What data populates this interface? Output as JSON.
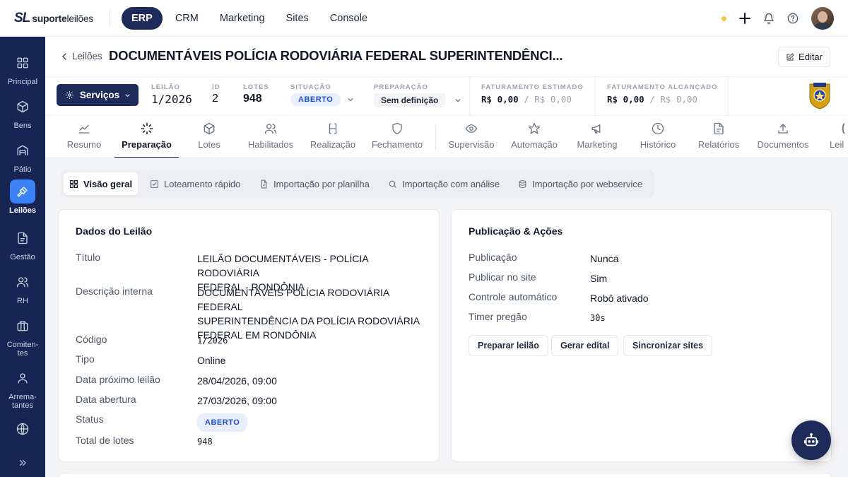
{
  "brand": {
    "mark": "SL",
    "name_bold": "suporte",
    "name_light": "leilões"
  },
  "top_nav": [
    "ERP",
    "CRM",
    "Marketing",
    "Sites",
    "Console"
  ],
  "sidebar": [
    {
      "label": "Principal",
      "icon": "dashboard-icon"
    },
    {
      "label": "Bens",
      "icon": "box-icon"
    },
    {
      "label": "Pátio",
      "icon": "warehouse-icon"
    },
    {
      "label": "Leilões",
      "icon": "gavel-icon"
    },
    {
      "label": "Gestão",
      "icon": "document-icon"
    },
    {
      "label": "RH",
      "icon": "users-icon"
    },
    {
      "label": "Comiten-tes",
      "icon": "briefcase-icon"
    },
    {
      "label": "Arrema-tantes",
      "icon": "user-icon"
    }
  ],
  "header": {
    "back_label": "Leilões",
    "title": "DOCUMENTÁVEIS POLÍCIA RODOVIÁRIA FEDERAL SUPERINTENDÊNCI...",
    "edit_label": "Editar"
  },
  "infobar": {
    "services_label": "Serviços",
    "leilao": {
      "key": "LEILÃO",
      "value": "1/2026"
    },
    "id": {
      "key": "ID",
      "value": "2"
    },
    "lotes": {
      "key": "LOTES",
      "value": "948"
    },
    "situacao": {
      "key": "SITUAÇÃO",
      "value": "ABERTO"
    },
    "preparacao": {
      "key": "PREPARAÇÃO",
      "value": "Sem definição"
    },
    "fat_estimado": {
      "key": "FATURAMENTO ESTIMADO",
      "value": "R$ 0,00",
      "sub": "/ R$ 0,00"
    },
    "fat_alcancado": {
      "key": "FATURAMENTO ALCANÇADO",
      "value": "R$ 0,00",
      "sub": "/ R$ 0,00"
    },
    "crest_text": "POLÍCIA"
  },
  "tabs": [
    "Resumo",
    "Preparação",
    "Lotes",
    "Habilitados",
    "Realização",
    "Fechamento",
    "Supervisão",
    "Automação",
    "Marketing",
    "Histórico",
    "Relatórios",
    "Documentos",
    "Leil"
  ],
  "subtabs": [
    "Visão geral",
    "Loteamento rápido",
    "Importação por planilha",
    "Importação com análise",
    "Importação por webservice"
  ],
  "dados": {
    "heading": "Dados do Leilão",
    "titulo": {
      "label": "Título",
      "line1": "LEILÃO DOCUMENTÁVEIS - POLÍCIA RODOVIÁRIA",
      "line2": "FEDERAL - RONDÔNIA"
    },
    "descricao": {
      "label": "Descrição interna",
      "line1": "DOCUMENTÁVEIS POLÍCIA RODOVIÁRIA FEDERAL",
      "line2": "SUPERINTENDÊNCIA DA POLÍCIA RODOVIÁRIA",
      "line3": "FEDERAL EM RONDÔNIA"
    },
    "codigo": {
      "label": "Código",
      "value": "1/2026"
    },
    "tipo": {
      "label": "Tipo",
      "value": "Online"
    },
    "proximo": {
      "label": "Data próximo leilão",
      "value": "28/04/2026, 09:00"
    },
    "abertura": {
      "label": "Data abertura",
      "value": "27/03/2026, 09:00"
    },
    "status": {
      "label": "Status",
      "value": "ABERTO"
    },
    "total": {
      "label": "Total de lotes",
      "value": "948"
    }
  },
  "publicacao": {
    "heading": "Publicação & Ações",
    "publicacao": {
      "label": "Publicação",
      "value": "Nunca"
    },
    "publicar_site": {
      "label": "Publicar no site",
      "value": "Sim"
    },
    "controle": {
      "label": "Controle automático",
      "value": "Robô ativado"
    },
    "timer": {
      "label": "Timer pregão",
      "value": "30s"
    },
    "buttons": [
      "Preparar leilão",
      "Gerar edital",
      "Sincronizar sites"
    ]
  },
  "colors": {
    "navy": "#1e2a5a",
    "sidebar": "#172554",
    "accent": "#3b82f6",
    "badge_bg": "#e7efff",
    "badge_text": "#1d4ed8"
  }
}
